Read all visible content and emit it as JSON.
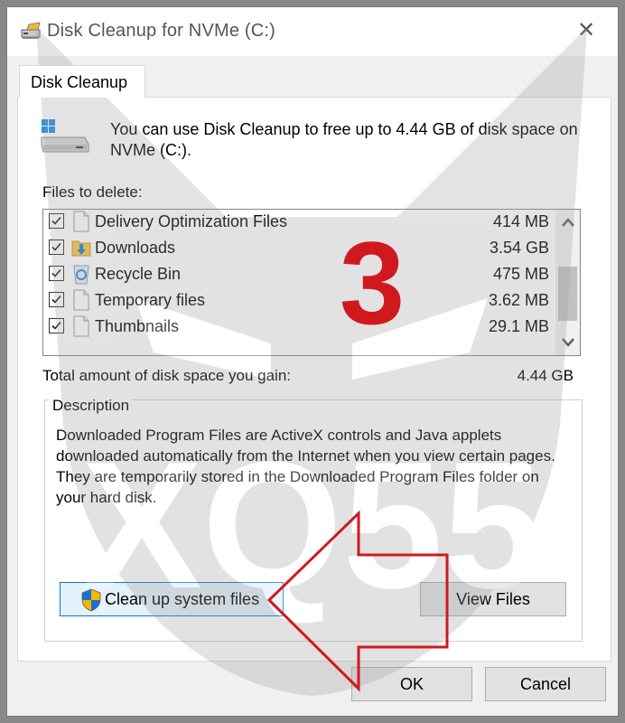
{
  "window": {
    "title": "Disk Cleanup for NVMe (C:)",
    "close_glyph": "✕"
  },
  "tab": {
    "label": "Disk Cleanup"
  },
  "intro_text": "You can use Disk Cleanup to free up to 4.44 GB of disk space on NVMe (C:).",
  "files_label": "Files to delete:",
  "files": [
    {
      "name": "Delivery Optimization Files",
      "size": "414 MB",
      "checked": true,
      "icon": "blank-file-icon"
    },
    {
      "name": "Downloads",
      "size": "3.54 GB",
      "checked": true,
      "icon": "downloads-folder-icon"
    },
    {
      "name": "Recycle Bin",
      "size": "475 MB",
      "checked": true,
      "icon": "recycle-bin-icon"
    },
    {
      "name": "Temporary files",
      "size": "3.62 MB",
      "checked": true,
      "icon": "blank-file-icon"
    },
    {
      "name": "Thumbnails",
      "size": "29.1 MB",
      "checked": true,
      "icon": "blank-file-icon"
    }
  ],
  "total": {
    "label": "Total amount of disk space you gain:",
    "value": "4.44 GB"
  },
  "description": {
    "legend": "Description",
    "text": "Downloaded Program Files are ActiveX controls and Java applets downloaded automatically from the Internet when you view certain pages. They are temporarily stored in the Downloaded Program Files folder on your hard disk."
  },
  "buttons": {
    "cleanup_system": "Clean up system files",
    "view_files": "View Files",
    "ok": "OK",
    "cancel": "Cancel"
  },
  "annotation": {
    "step_number": "3",
    "watermark": "XQ55"
  },
  "colors": {
    "accent": "#0078d7",
    "annotation_red": "#d0191f"
  }
}
